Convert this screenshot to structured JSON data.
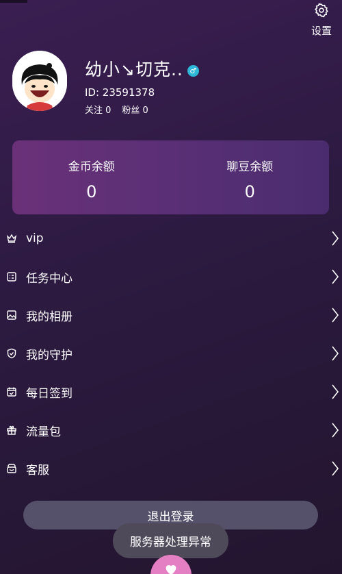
{
  "header": {
    "settings_label": "设置"
  },
  "profile": {
    "name": "幼小↘切克..",
    "gender_symbol": "♂",
    "id_text": "ID: 23591378",
    "following": "关注 0",
    "followers": "粉丝 0"
  },
  "balance": {
    "gold_label": "金币余额",
    "gold_value": "0",
    "beans_label": "聊豆余额",
    "beans_value": "0"
  },
  "menu": [
    {
      "label": "vip",
      "icon": "crown-icon"
    },
    {
      "label": "任务中心",
      "icon": "task-list-icon"
    },
    {
      "label": "我的相册",
      "icon": "image-icon"
    },
    {
      "label": "我的守护",
      "icon": "shield-check-icon"
    },
    {
      "label": "每日签到",
      "icon": "calendar-check-icon"
    },
    {
      "label": "流量包",
      "icon": "gift-icon"
    },
    {
      "label": "客服",
      "icon": "customer-service-icon"
    }
  ],
  "logout_label": "退出登录",
  "toast_text": "服务器处理异常",
  "colors": {
    "background": "#2c1a40",
    "card_gradient_start": "#6a3179",
    "gender_badge": "#2db8d9",
    "logout_button": "#56516a",
    "fab": "#e57fc4"
  }
}
